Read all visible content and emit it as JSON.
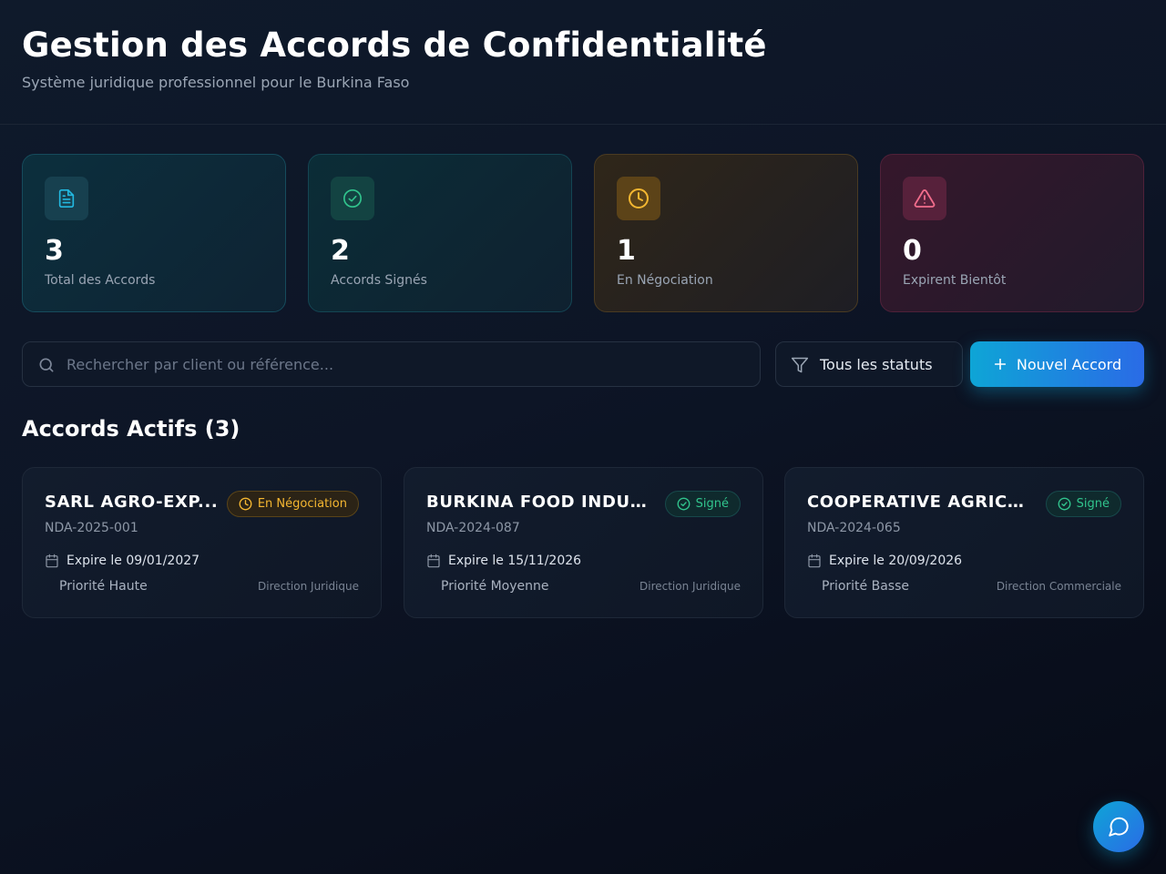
{
  "header": {
    "title": "Gestion des Accords de Confidentialité",
    "subtitle": "Système juridique professionnel pour le Burkina Faso"
  },
  "stats": [
    {
      "value": "3",
      "label": "Total des Accords",
      "icon": "file-text-icon",
      "color": "#22b8e0"
    },
    {
      "value": "2",
      "label": "Accords Signés",
      "icon": "check-circle-icon",
      "color": "#31c48d"
    },
    {
      "value": "1",
      "label": "En Négociation",
      "icon": "clock-icon",
      "color": "#f5b731"
    },
    {
      "value": "0",
      "label": "Expirent Bientôt",
      "icon": "alert-triangle-icon",
      "color": "#f26d8c"
    }
  ],
  "toolbar": {
    "search_placeholder": "Rechercher par client ou référence...",
    "filter_label": "Tous les statuts",
    "new_button_label": "Nouvel Accord"
  },
  "section": {
    "title": "Accords Actifs (3)"
  },
  "ndas": [
    {
      "client": "SARL AGRO-EXPORT BURKINA",
      "client_display": "SARL AGRO-EXP...",
      "status": "En Négociation",
      "status_type": "negotiation",
      "reference": "NDA-2025-001",
      "expiry": "Expire le 09/01/2027",
      "priority": "Priorité Haute",
      "department": "Direction Juridique"
    },
    {
      "client": "BURKINA FOOD INDUSTRIES",
      "client_display": "BURKINA FOOD INDUS...",
      "status": "Signé",
      "status_type": "signed",
      "reference": "NDA-2024-087",
      "expiry": "Expire le 15/11/2026",
      "priority": "Priorité Moyenne",
      "department": "Direction Juridique"
    },
    {
      "client": "COOPERATIVE AGRICOLE",
      "client_display": "COOPERATIVE AGRICO...",
      "status": "Signé",
      "status_type": "signed",
      "reference": "NDA-2024-065",
      "expiry": "Expire le 20/09/2026",
      "priority": "Priorité Basse",
      "department": "Direction Commerciale"
    }
  ],
  "colors": {
    "accent": "#0ea5d6",
    "accent_end": "#2a6be6",
    "negotiation": "#f5b731",
    "signed": "#31c48d"
  }
}
